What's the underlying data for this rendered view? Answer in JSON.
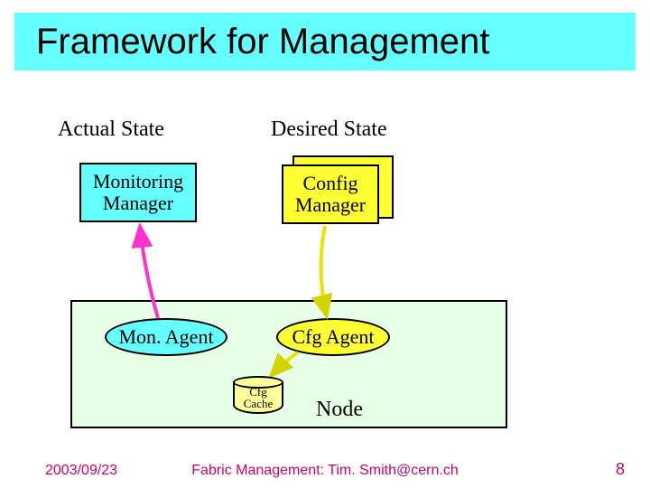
{
  "title": "Framework for Management",
  "labels": {
    "actual_state": "Actual State",
    "desired_state": "Desired State"
  },
  "boxes": {
    "monitoring_manager_l1": "Monitoring",
    "monitoring_manager_l2": "Manager",
    "config_manager_l1": "Config",
    "config_manager_l2": "Manager"
  },
  "agents": {
    "mon_agent": "Mon. Agent",
    "cfg_agent": "Cfg Agent"
  },
  "cache": {
    "l1": "Cfg",
    "l2": "Cache"
  },
  "node_label": "Node",
  "footer": {
    "date": "2003/09/23",
    "center": "Fabric Management: Tim. Smith@cern.ch",
    "page": "8"
  },
  "chart_data": {
    "type": "diagram",
    "title": "Framework for Management",
    "groups": [
      {
        "name": "Actual State",
        "manager": "Monitoring Manager",
        "agent": "Mon. Agent"
      },
      {
        "name": "Desired State",
        "manager": "Config Manager",
        "agent": "Cfg Agent"
      }
    ],
    "node": {
      "label": "Node",
      "contains": [
        "Mon. Agent",
        "Cfg Agent",
        "Cfg Cache"
      ]
    },
    "edges": [
      {
        "from": "Mon. Agent",
        "to": "Monitoring Manager",
        "direction": "up"
      },
      {
        "from": "Config Manager",
        "to": "Cfg Agent",
        "direction": "down"
      },
      {
        "from": "Cfg Agent",
        "to": "Cfg Cache",
        "direction": "down"
      }
    ]
  }
}
